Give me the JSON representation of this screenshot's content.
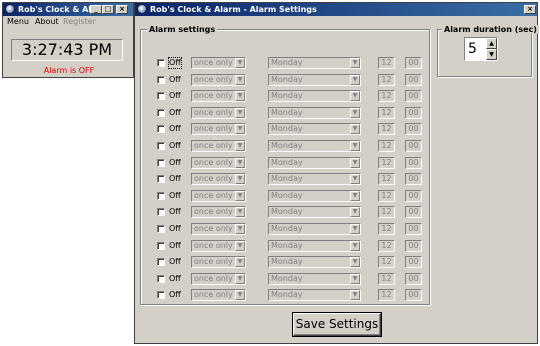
{
  "clock_window": {
    "title": "Rob's Clock & Al...",
    "menu": [
      "Menu",
      "About",
      "Register"
    ],
    "time": "3:27:43 PM",
    "alarm_status": "Alarm is OFF"
  },
  "settings_window": {
    "title": "Rob's Clock & Alarm - Alarm Settings",
    "alarm_settings_label": "Alarm settings",
    "duration_label": "Alarm duration (sec)",
    "duration_value": "5",
    "save_label": "Save Settings",
    "alarms": [
      {
        "enabled": false,
        "label": "Off",
        "frequency": "once only",
        "day": "Monday",
        "hour": "12",
        "minute": "00"
      },
      {
        "enabled": false,
        "label": "Off",
        "frequency": "once only",
        "day": "Monday",
        "hour": "12",
        "minute": "00"
      },
      {
        "enabled": false,
        "label": "Off",
        "frequency": "once only",
        "day": "Monday",
        "hour": "12",
        "minute": "00"
      },
      {
        "enabled": false,
        "label": "Off",
        "frequency": "once only",
        "day": "Monday",
        "hour": "12",
        "minute": "00"
      },
      {
        "enabled": false,
        "label": "Off",
        "frequency": "once only",
        "day": "Monday",
        "hour": "12",
        "minute": "00"
      },
      {
        "enabled": false,
        "label": "Off",
        "frequency": "once only",
        "day": "Monday",
        "hour": "12",
        "minute": "00"
      },
      {
        "enabled": false,
        "label": "Off",
        "frequency": "once only",
        "day": "Monday",
        "hour": "12",
        "minute": "00"
      },
      {
        "enabled": false,
        "label": "Off",
        "frequency": "once only",
        "day": "Monday",
        "hour": "12",
        "minute": "00"
      },
      {
        "enabled": false,
        "label": "Off",
        "frequency": "once only",
        "day": "Monday",
        "hour": "12",
        "minute": "00"
      },
      {
        "enabled": false,
        "label": "Off",
        "frequency": "once only",
        "day": "Monday",
        "hour": "12",
        "minute": "00"
      },
      {
        "enabled": false,
        "label": "Off",
        "frequency": "once only",
        "day": "Monday",
        "hour": "12",
        "minute": "00"
      },
      {
        "enabled": false,
        "label": "Off",
        "frequency": "once only",
        "day": "Monday",
        "hour": "12",
        "minute": "00"
      },
      {
        "enabled": false,
        "label": "Off",
        "frequency": "once only",
        "day": "Monday",
        "hour": "12",
        "minute": "00"
      },
      {
        "enabled": false,
        "label": "Off",
        "frequency": "once only",
        "day": "Monday",
        "hour": "12",
        "minute": "00"
      },
      {
        "enabled": false,
        "label": "Off",
        "frequency": "once only",
        "day": "Monday",
        "hour": "12",
        "minute": "00"
      }
    ]
  },
  "icons": {
    "minimize": "_",
    "maximize": "□",
    "close": "×",
    "dropdown": "▼",
    "spin_up": "▲",
    "spin_down": "▼"
  },
  "colors": {
    "titlebar_start": "#0a246a",
    "titlebar_end": "#3a6ea5",
    "face": "#d4d0c8",
    "alarm_off": "#e00000",
    "disabled_text": "#808080"
  }
}
